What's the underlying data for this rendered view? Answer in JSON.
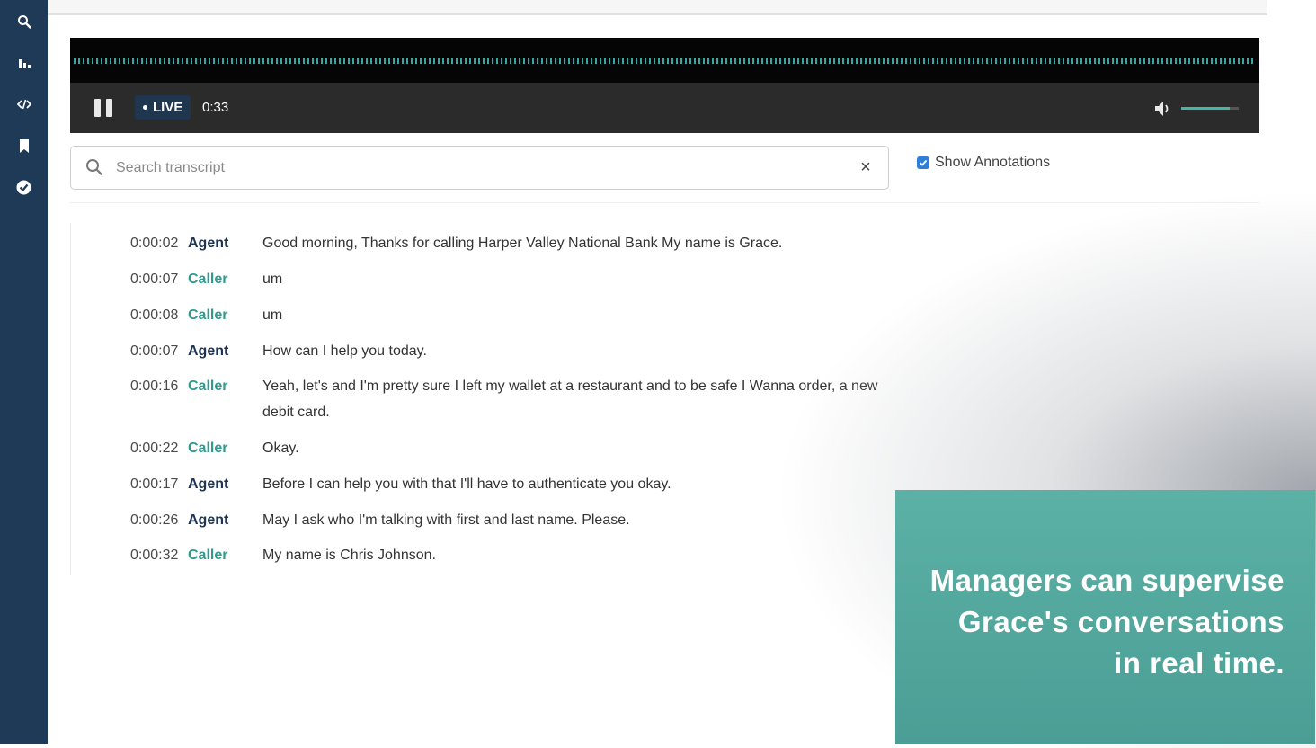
{
  "sidebar": {
    "icons": [
      "search-icon",
      "bar-chart-icon",
      "code-icon",
      "bookmark-icon",
      "check-circle-icon"
    ]
  },
  "player": {
    "live_label": "LIVE",
    "time": "0:33",
    "volume_level": 0.85,
    "accent": "#48b5aa"
  },
  "search": {
    "placeholder": "Search transcript",
    "clear_symbol": "×"
  },
  "annotations": {
    "label": "Show Annotations",
    "checked": true
  },
  "transcript": [
    {
      "time": "0:00:02",
      "speaker": "Agent",
      "text": "Good morning, Thanks for calling Harper Valley National Bank My name is Grace."
    },
    {
      "time": "0:00:07",
      "speaker": "Caller",
      "text": "um"
    },
    {
      "time": "0:00:08",
      "speaker": "Caller",
      "text": "um"
    },
    {
      "time": "0:00:07",
      "speaker": "Agent",
      "text": "How can I help you today."
    },
    {
      "time": "0:00:16",
      "speaker": "Caller",
      "text": "Yeah, let's and I'm pretty sure I left my wallet at a restaurant and to be safe I Wanna order, a new debit card."
    },
    {
      "time": "0:00:22",
      "speaker": "Caller",
      "text": "Okay."
    },
    {
      "time": "0:00:17",
      "speaker": "Agent",
      "text": "Before I can help you with that I'll have to authenticate you okay."
    },
    {
      "time": "0:00:26",
      "speaker": "Agent",
      "text": "May I ask who I'm talking with first and last name. Please."
    },
    {
      "time": "0:00:32",
      "speaker": "Caller",
      "text": "My name is Chris Johnson."
    }
  ],
  "caption": {
    "text": "Managers can supervise\nGrace's conversations\nin real time."
  },
  "colors": {
    "sidebar": "#1f3a57",
    "agent": "#1d3552",
    "caller": "#2f9a8d",
    "caption_bg": "#52a89e"
  }
}
